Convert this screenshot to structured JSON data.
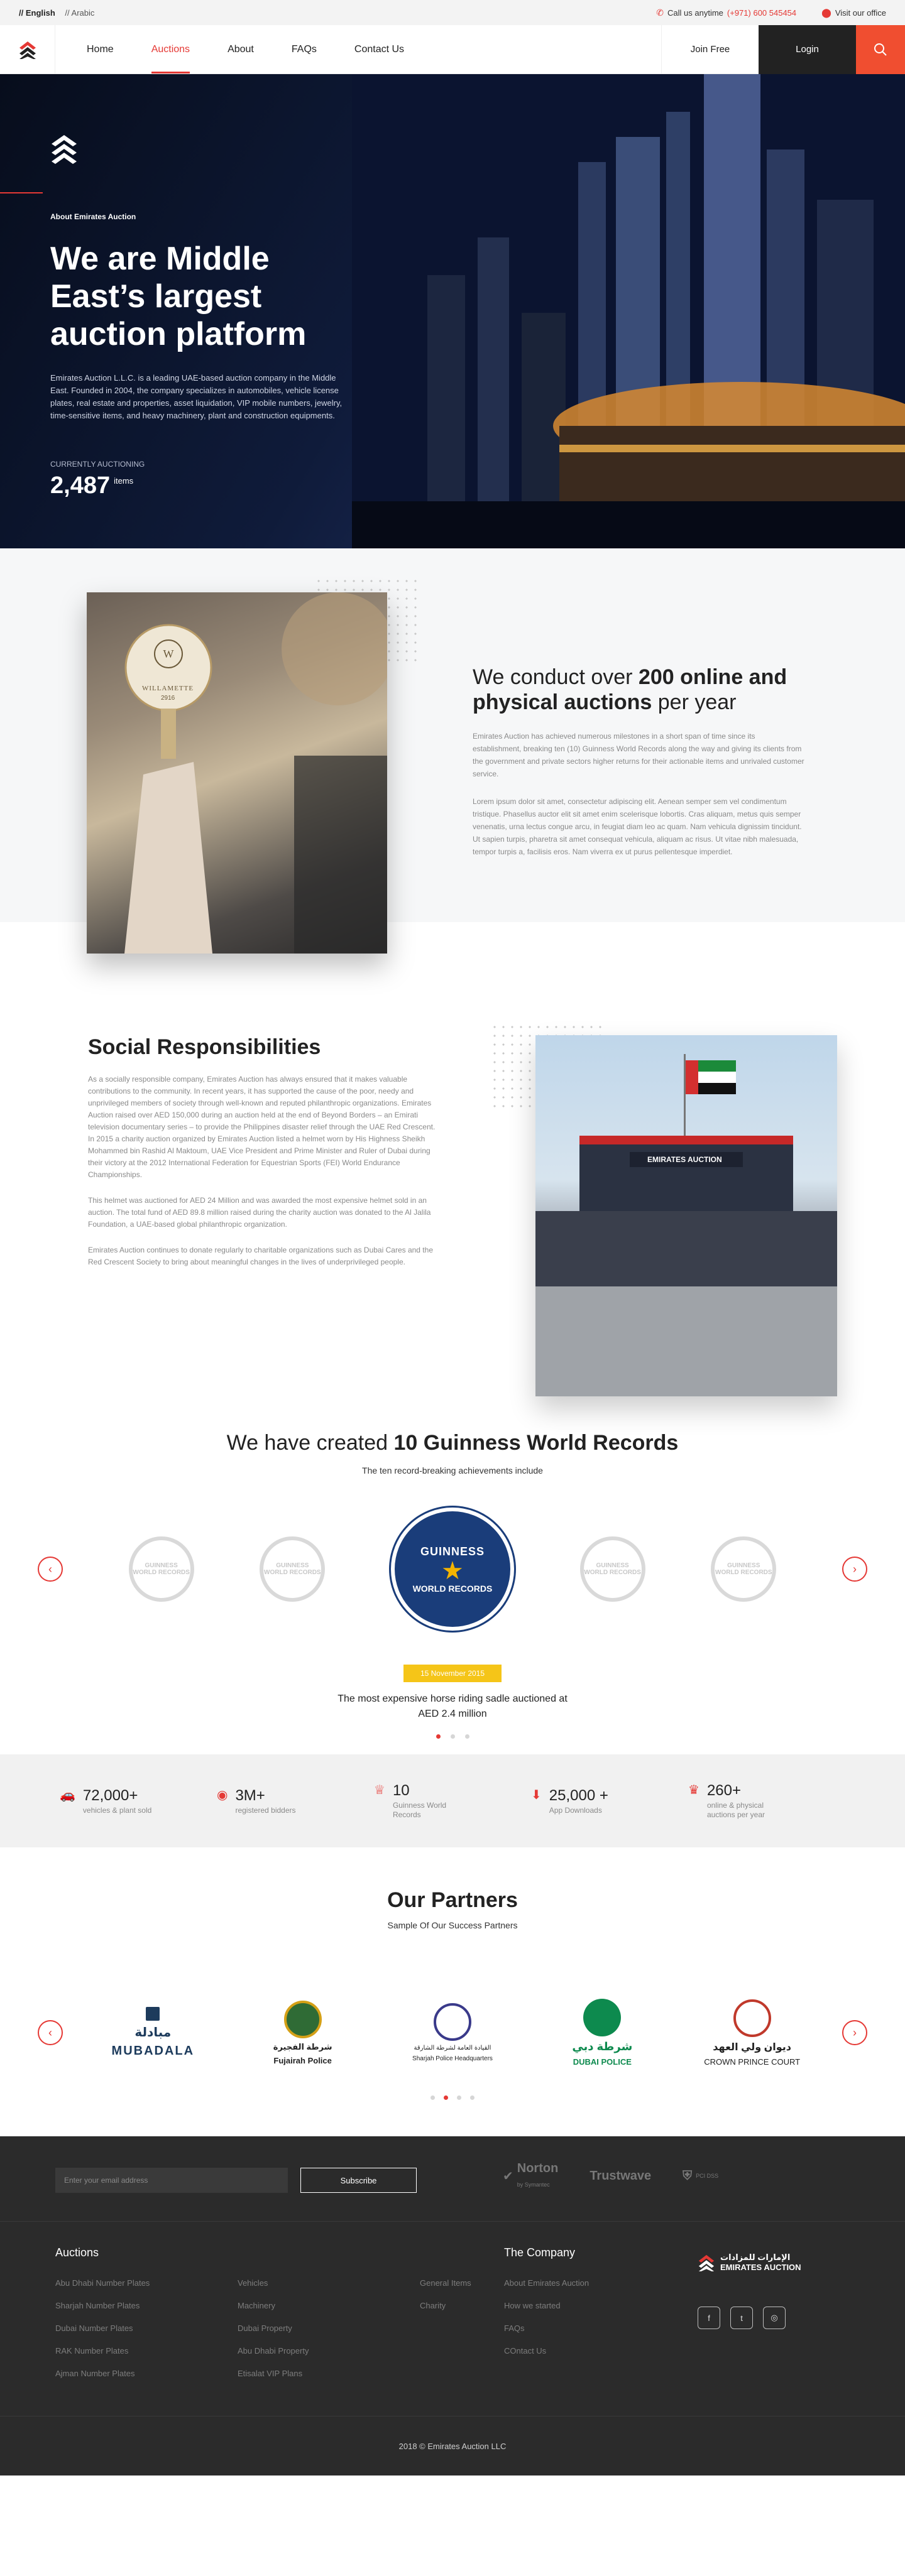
{
  "topbar": {
    "lang_en": "// English",
    "lang_ar": "// Arabic",
    "call_label": "Call us anytime",
    "phone": "(+971) 600 545454",
    "office": "Visit our office"
  },
  "nav": {
    "items": [
      "Home",
      "Auctions",
      "About",
      "FAQs",
      "Contact Us"
    ],
    "active": "Auctions",
    "join": "Join Free",
    "login": "Login"
  },
  "hero": {
    "tag": "About Emirates Auction",
    "title": "We are Middle East’s largest auction platform",
    "description": "Emirates Auction L.L.C. is a leading UAE-based auction company in the Middle East. Founded in 2004, the company specializes in automobiles, vehicle license plates, real estate and properties, asset liquidation, VIP mobile numbers, jewelry, time-sensitive items, and heavy machinery, plant and construction equipments.",
    "counting_label": "CURRENTLY AUCTIONING",
    "count": "2,487",
    "count_unit": "items"
  },
  "conduct": {
    "title_pre": "We conduct over ",
    "title_bold": "200 online and physical auctions",
    "title_post": " per year",
    "p1": "Emirates Auction has achieved numerous milestones in a short span of time since its establishment, breaking ten (10) Guinness World Records along the way and giving its clients from the government and private sectors higher returns for their actionable items and unrivaled customer service.",
    "p2": "Lorem ipsum dolor sit amet, consectetur adipiscing elit. Aenean semper sem vel condimentum tristique. Phasellus auctor elit sit amet enim scelerisque lobortis. Cras aliquam, metus quis semper venenatis, urna lectus congue arcu, in feugiat diam leo ac quam. Nam vehicula dignissim tincidunt. Ut sapien turpis, pharetra sit amet consequat vehicula, aliquam ac risus. Ut vitae nibh malesuada, tempor turpis a, facilisis eros. Nam viverra ex ut purus pellentesque imperdiet.",
    "paddle_text": "WILLAMETTE",
    "paddle_num": "2916"
  },
  "social": {
    "title": "Social Responsibilities",
    "p1": "As a socially responsible company, Emirates Auction has always ensured that it makes valuable contributions to the community. In recent years, it has supported the cause of the poor, needy and unprivileged members of society through well-known and reputed philanthropic organizations. Emirates Auction raised over AED 150,000 during an auction held at the end of Beyond Borders – an Emirati television documentary series – to provide the Philippines disaster relief through the UAE Red Crescent. In 2015 a charity auction organized by Emirates Auction listed a helmet worn by His Highness Sheikh Mohammed bin Rashid Al Maktoum, UAE Vice President and Prime Minister and Ruler of Dubai during their victory at the 2012 International Federation for Equestrian Sports (FEI) World Endurance Championships.",
    "p2": "This helmet was auctioned for AED 24 Million and was awarded the most expensive helmet sold in an auction. The total fund of AED 89.8 million raised during the charity auction was donated to the Al Jalila Foundation, a UAE-based global philanthropic organization.",
    "p3": "Emirates Auction continues to donate regularly to charitable organizations such as Dubai Cares and the Red Crescent Society to bring about meaningful changes in the lives of underprivileged people.",
    "banner_text": "EMIRATES AUCTION"
  },
  "guinness": {
    "title_pre": "We have created ",
    "title_bold": "10 Guinness World Records",
    "subtitle": "The ten record-breaking achievements include",
    "badge_small": "GUINNESS WORLD RECORDS",
    "badge_big_top": "GUINNESS",
    "badge_big_bottom": "WORLD RECORDS",
    "date": "15 November 2015",
    "caption": "The most expensive horse riding sadle auctioned at AED 2.4 million"
  },
  "stats": [
    {
      "icon": "car-icon",
      "value": "72,000+",
      "label": "vehicles & plant sold"
    },
    {
      "icon": "bidder-icon",
      "value": "3M+",
      "label": "registered bidders"
    },
    {
      "icon": "award-icon",
      "value": "10",
      "label": "Guinness World Records"
    },
    {
      "icon": "download-icon",
      "value": "25,000 +",
      "label": "App Downloads"
    },
    {
      "icon": "auction-icon",
      "value": "260+",
      "label": "online & physical auctions per year"
    }
  ],
  "partners": {
    "title": "Our Partners",
    "subtitle": "Sample Of Our Success Partners",
    "logos": [
      {
        "name": "MUBADALA",
        "arabic": "مبادلة",
        "color": "#1d3b5c"
      },
      {
        "name": "Fujairah Police",
        "arabic": "شرطة الفجيرة",
        "color": "#2f6b35"
      },
      {
        "name": "Sharjah Police Headquarters",
        "arabic": "القيادة العامة لشرطة الشارقة",
        "color": "#3a3a8a"
      },
      {
        "name": "DUBAI POLICE",
        "arabic": "شرطة دبي",
        "color": "#0d8a4e"
      },
      {
        "name": "CROWN PRINCE COURT",
        "arabic": "ديوان ولي العهد",
        "color": "#c0392b"
      }
    ]
  },
  "footer": {
    "email_placeholder": "Enter your email address",
    "subscribe": "Subscribe",
    "badge_norton": "Norton",
    "badge_norton_sub": "by Symantec",
    "badge_trustwave": "Trustwave",
    "badge_pci": "PCI DSS",
    "auctions_title": "Auctions",
    "col1": [
      "Abu Dhabi Number Plates",
      "Sharjah Number Plates",
      "Dubai Number Plates",
      "RAK Number Plates",
      "Ajman Number Plates"
    ],
    "col2": [
      "Vehicles",
      "Machinery",
      "Dubai Property",
      "Abu Dhabi Property",
      "Etisalat VIP Plans"
    ],
    "col3": [
      "General Items",
      "Charity"
    ],
    "company_title": "The Company",
    "company": [
      "About Emirates Auction",
      "How we started",
      "FAQs",
      "COntact Us"
    ],
    "brand_name": "EMIRATES AUCTION",
    "brand_arabic": "الإمارات للمزادات",
    "copyright": "2018 © Emirates Auction LLC"
  },
  "colors": {
    "accent": "#e53935",
    "dark": "#2b2b2b",
    "yellow": "#f5c518"
  }
}
